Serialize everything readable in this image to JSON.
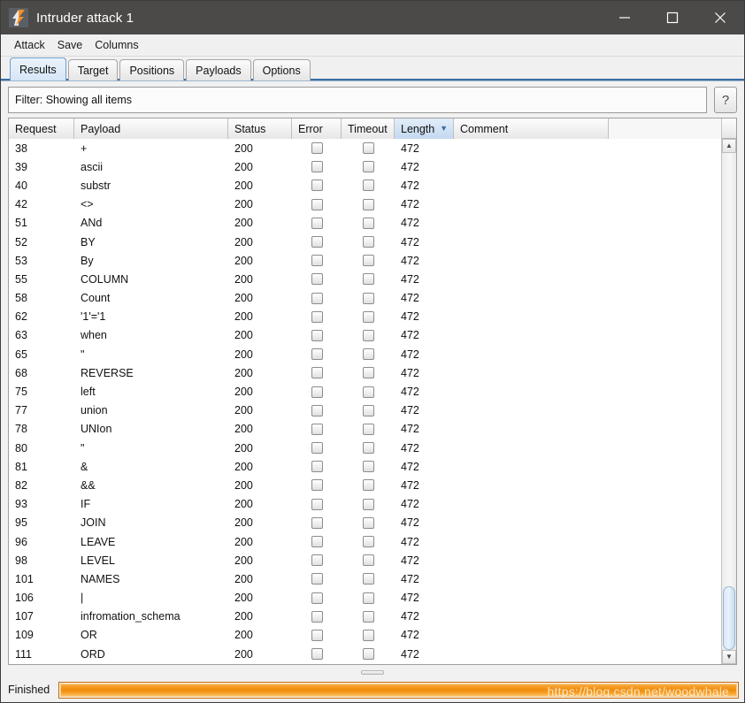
{
  "window": {
    "title": "Intruder attack 1",
    "icon": "burp-lightning-icon",
    "minimize_label": "Minimize",
    "maximize_label": "Maximize",
    "close_label": "Close"
  },
  "menubar": {
    "items": [
      {
        "label": "Attack"
      },
      {
        "label": "Save"
      },
      {
        "label": "Columns"
      }
    ]
  },
  "tabs": [
    {
      "label": "Results",
      "selected": true
    },
    {
      "label": "Target",
      "selected": false
    },
    {
      "label": "Positions",
      "selected": false
    },
    {
      "label": "Payloads",
      "selected": false
    },
    {
      "label": "Options",
      "selected": false
    }
  ],
  "filter": {
    "text": "Filter: Showing all items",
    "help_label": "?"
  },
  "table": {
    "columns": [
      {
        "key": "request",
        "label": "Request",
        "sorted": false
      },
      {
        "key": "payload",
        "label": "Payload",
        "sorted": false
      },
      {
        "key": "status",
        "label": "Status",
        "sorted": false
      },
      {
        "key": "error",
        "label": "Error",
        "sorted": false
      },
      {
        "key": "timeout",
        "label": "Timeout",
        "sorted": false
      },
      {
        "key": "length",
        "label": "Length",
        "sorted": true,
        "sort_direction": "desc",
        "sort_glyph": "▼"
      },
      {
        "key": "comment",
        "label": "Comment",
        "sorted": false
      }
    ],
    "rows": [
      {
        "request": "38",
        "payload": "+",
        "status": "200",
        "error": false,
        "timeout": false,
        "length": "472",
        "comment": ""
      },
      {
        "request": "39",
        "payload": "ascii",
        "status": "200",
        "error": false,
        "timeout": false,
        "length": "472",
        "comment": ""
      },
      {
        "request": "40",
        "payload": "substr",
        "status": "200",
        "error": false,
        "timeout": false,
        "length": "472",
        "comment": ""
      },
      {
        "request": "42",
        "payload": "<>",
        "status": "200",
        "error": false,
        "timeout": false,
        "length": "472",
        "comment": ""
      },
      {
        "request": "51",
        "payload": "ANd",
        "status": "200",
        "error": false,
        "timeout": false,
        "length": "472",
        "comment": ""
      },
      {
        "request": "52",
        "payload": "BY",
        "status": "200",
        "error": false,
        "timeout": false,
        "length": "472",
        "comment": ""
      },
      {
        "request": "53",
        "payload": "By",
        "status": "200",
        "error": false,
        "timeout": false,
        "length": "472",
        "comment": ""
      },
      {
        "request": "55",
        "payload": "COLUMN",
        "status": "200",
        "error": false,
        "timeout": false,
        "length": "472",
        "comment": ""
      },
      {
        "request": "58",
        "payload": "Count",
        "status": "200",
        "error": false,
        "timeout": false,
        "length": "472",
        "comment": ""
      },
      {
        "request": "62",
        "payload": "'1'='1",
        "status": "200",
        "error": false,
        "timeout": false,
        "length": "472",
        "comment": ""
      },
      {
        "request": "63",
        "payload": "when",
        "status": "200",
        "error": false,
        "timeout": false,
        "length": "472",
        "comment": ""
      },
      {
        "request": "65",
        "payload": "\"",
        "status": "200",
        "error": false,
        "timeout": false,
        "length": "472",
        "comment": ""
      },
      {
        "request": "68",
        "payload": "REVERSE",
        "status": "200",
        "error": false,
        "timeout": false,
        "length": "472",
        "comment": ""
      },
      {
        "request": "75",
        "payload": "left",
        "status": "200",
        "error": false,
        "timeout": false,
        "length": "472",
        "comment": ""
      },
      {
        "request": "77",
        "payload": "union",
        "status": "200",
        "error": false,
        "timeout": false,
        "length": "472",
        "comment": ""
      },
      {
        "request": "78",
        "payload": "UNIon",
        "status": "200",
        "error": false,
        "timeout": false,
        "length": "472",
        "comment": ""
      },
      {
        "request": "80",
        "payload": "\"",
        "status": "200",
        "error": false,
        "timeout": false,
        "length": "472",
        "comment": ""
      },
      {
        "request": "81",
        "payload": "&",
        "status": "200",
        "error": false,
        "timeout": false,
        "length": "472",
        "comment": ""
      },
      {
        "request": "82",
        "payload": "&&",
        "status": "200",
        "error": false,
        "timeout": false,
        "length": "472",
        "comment": ""
      },
      {
        "request": "93",
        "payload": "IF",
        "status": "200",
        "error": false,
        "timeout": false,
        "length": "472",
        "comment": ""
      },
      {
        "request": "95",
        "payload": "JOIN",
        "status": "200",
        "error": false,
        "timeout": false,
        "length": "472",
        "comment": ""
      },
      {
        "request": "96",
        "payload": "LEAVE",
        "status": "200",
        "error": false,
        "timeout": false,
        "length": "472",
        "comment": ""
      },
      {
        "request": "98",
        "payload": "LEVEL",
        "status": "200",
        "error": false,
        "timeout": false,
        "length": "472",
        "comment": ""
      },
      {
        "request": "101",
        "payload": "NAMES",
        "status": "200",
        "error": false,
        "timeout": false,
        "length": "472",
        "comment": ""
      },
      {
        "request": "106",
        "payload": "|",
        "status": "200",
        "error": false,
        "timeout": false,
        "length": "472",
        "comment": ""
      },
      {
        "request": "107",
        "payload": "infromation_schema",
        "status": "200",
        "error": false,
        "timeout": false,
        "length": "472",
        "comment": ""
      },
      {
        "request": "109",
        "payload": "OR",
        "status": "200",
        "error": false,
        "timeout": false,
        "length": "472",
        "comment": ""
      },
      {
        "request": "111",
        "payload": "ORD",
        "status": "200",
        "error": false,
        "timeout": false,
        "length": "472",
        "comment": ""
      }
    ]
  },
  "scrollbar": {
    "up_glyph": "▲",
    "down_glyph": "▼"
  },
  "statusbar": {
    "status": "Finished",
    "progress_percent": 100,
    "watermark": "https://blog.csdn.net/woodwhale"
  },
  "colors": {
    "titlebar": "#4c4a48",
    "accent_orange": "#f09000",
    "sort_highlight": "#c3d9f0",
    "tab_selected": "#d6e6f7"
  }
}
